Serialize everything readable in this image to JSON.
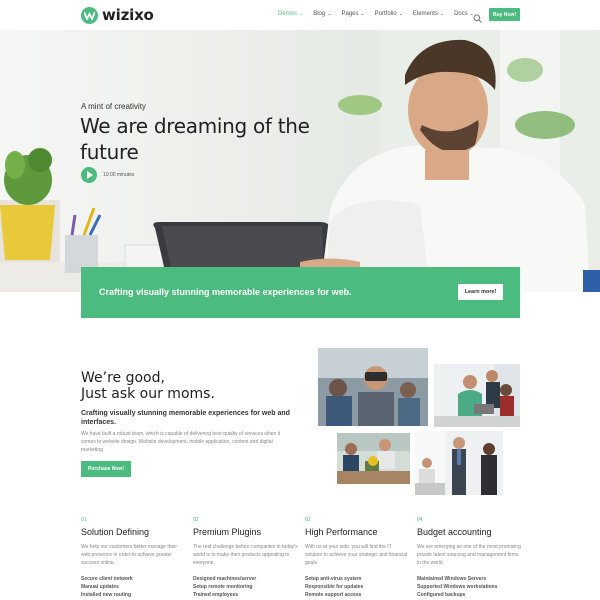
{
  "header": {
    "logo_text": "wizixo",
    "nav": [
      {
        "label": "Demos",
        "active": true
      },
      {
        "label": "Blog",
        "active": false
      },
      {
        "label": "Pages",
        "active": false
      },
      {
        "label": "Portfolio",
        "active": false
      },
      {
        "label": "Elements",
        "active": false
      },
      {
        "label": "Docs",
        "active": false
      }
    ],
    "search_icon": "search-icon",
    "buy_label": "Buy Now!"
  },
  "hero": {
    "tagline": "A mint of creativity",
    "title": "We are dreaming of the future",
    "play_icon": "play-icon",
    "duration": "10:00 minutes"
  },
  "cta": {
    "text": "Crafting visually stunning memorable experiences for web.",
    "button": "Learn more!"
  },
  "about": {
    "title_line1": "We’re good,",
    "title_line2": "Just ask our moms.",
    "subtitle": "Crafting visually stunning memorable experiences for web and interfaces.",
    "body": "We have built a robust team, which is capable of delivering best quality of services when it comes to website design, Website development, mobile application, content and digital marketing",
    "button": "Purchase Now!"
  },
  "features": [
    {
      "num": "01",
      "title": "Solution Defining",
      "desc": "We help our customers better manage their web presence in order to achieve greater success online.",
      "items": [
        "Secure client network",
        "Manual updates",
        "Installed new routing"
      ]
    },
    {
      "num": "02",
      "title": "Premium Plugins",
      "desc": "The real challenge before companies in today's world is to make their products appealing to everyone.",
      "items": [
        "Designed machines/server",
        "Setup remote monitoring",
        "Trained employees"
      ]
    },
    {
      "num": "03",
      "title": "High Performance",
      "desc": "With us at your side, you will find the IT solution to achieve your strategic and financial goals",
      "items": [
        "Setup anti-virus system",
        "Responsible for updates",
        "Remote support access"
      ]
    },
    {
      "num": "04",
      "title": "Budget accounting",
      "desc": "We are emerging as one of the most promising private talent sourcing and management firms in the world.",
      "items": [
        "Maintained Windows Servers",
        "Supported Windows workstations",
        "Configured backups"
      ]
    }
  ],
  "colors": {
    "accent": "#4cbb7f",
    "heading": "#222222",
    "muted": "#888888"
  }
}
